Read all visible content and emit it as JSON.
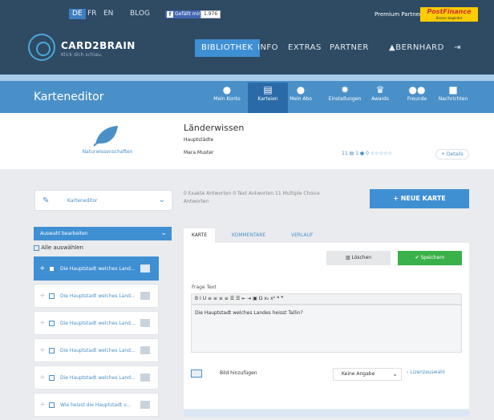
{
  "topbar": {
    "languages": [
      "DE",
      "FR",
      "EN"
    ],
    "active_language": "DE",
    "blog": "BLOG",
    "fb_like": "Gefällt mir",
    "fb_count": "1.976",
    "premium": "Premium Partner",
    "sponsor": "PostFinance",
    "sponsor_sub": "Besser begleitet"
  },
  "header": {
    "brand": "CARD2BRAIN",
    "tagline": "Klick dich schlau.",
    "nav": [
      "BIBLIOTHEK",
      "INFO",
      "EXTRAS",
      "PARTNER"
    ],
    "user": "BERNHARD"
  },
  "band": {
    "title": "Karteneditor",
    "tabs": [
      {
        "label": "Mein Konto",
        "icon": "user-icon"
      },
      {
        "label": "Karteien",
        "icon": "cards-icon"
      },
      {
        "label": "Mein Abo",
        "icon": "subscription-icon"
      },
      {
        "label": "Einstellungen",
        "icon": "gear-icon"
      },
      {
        "label": "Awards",
        "icon": "trophy-icon"
      },
      {
        "label": "Freunde",
        "icon": "friends-icon"
      },
      {
        "label": "Nachrichten",
        "icon": "message-icon"
      }
    ]
  },
  "deck": {
    "category": "Naturwissenschaften",
    "title": "Länderwissen",
    "subtitle": "Hauptstädte",
    "author": "Mara Muster",
    "stats_cards": "11",
    "stats_users": "1",
    "stats_rating": "0",
    "details": "+ Details"
  },
  "sidebar": {
    "dropdown_label": "Karteneditor",
    "select_edit": "Auswahl bearbeiten",
    "select_all": "Alle auswählen",
    "items": [
      "Die Hauptstadt welches Land...",
      "Die Hauptstadt welches Land...",
      "Die Hauptstadt welches Land...",
      "Die Hauptstadt welches Land...",
      "Die Hauptstadt welches Land...",
      "Wie heisst die Hauptstadt v..."
    ]
  },
  "summary": {
    "counts": "0 Exakte Antworten   0 Text Antworten   11 Multiple Choice Antworten",
    "new_card": "+ NEUE KARTE"
  },
  "editor": {
    "tabs": [
      "KARTE",
      "KOMMENTARE",
      "VERLAUF"
    ],
    "delete": "Löschen",
    "save": "Speichern",
    "question_label": "Frage Text",
    "toolbar": "B  I  U   ≡  ≡  ≡  ≡   ☰  ☰  ⇤  ⇥   ▣   Ω   x₂  x²   ❝  ❞",
    "question": "Die Hauptstadt welches Landes heisst Tallin?",
    "image_add": "Bild hinzufügen",
    "license_select": "Keine Angabe",
    "license_link": "› Lizenzauswahl"
  }
}
